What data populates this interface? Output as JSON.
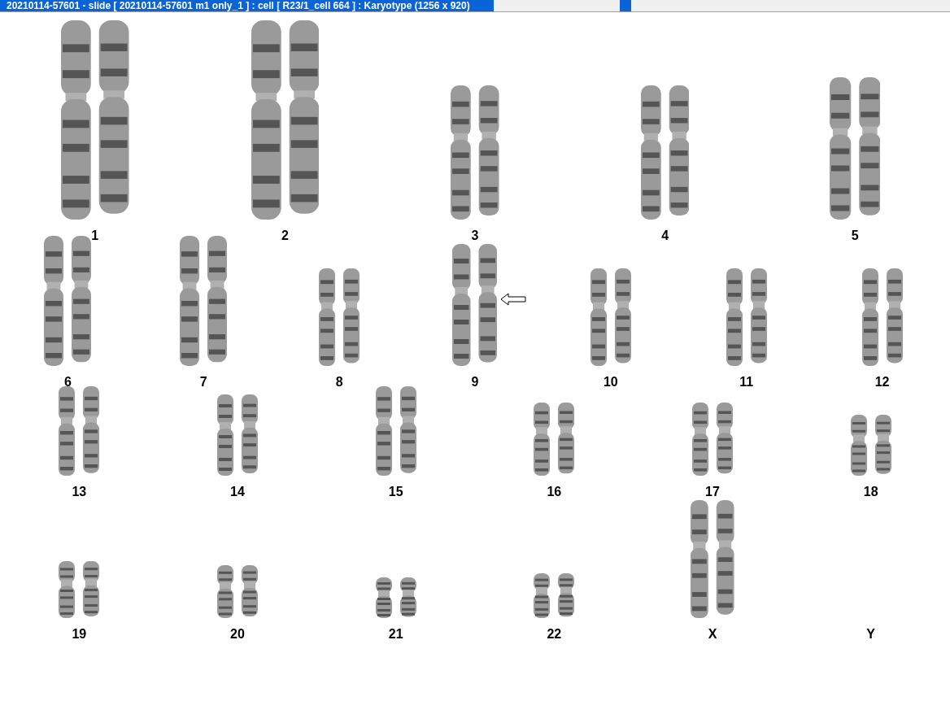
{
  "window": {
    "title": "20210114-57601 - slide [ 20210114-57601 m1 only_1 ] : cell [ R23/1_cell 664 ] : Karyotype  (1256 x 920)"
  },
  "rows": [
    {
      "pairs": [
        {
          "label": "1",
          "kind": "pair",
          "marked": false
        },
        {
          "label": "2",
          "kind": "pair",
          "marked": false
        },
        {
          "label": "3",
          "kind": "pair",
          "marked": false
        },
        {
          "label": "4",
          "kind": "pair",
          "marked": false
        },
        {
          "label": "5",
          "kind": "pair",
          "marked": false
        }
      ]
    },
    {
      "pairs": [
        {
          "label": "6",
          "kind": "pair",
          "marked": false
        },
        {
          "label": "7",
          "kind": "pair",
          "marked": false
        },
        {
          "label": "8",
          "kind": "pair",
          "marked": false
        },
        {
          "label": "9",
          "kind": "pair",
          "marked": true
        },
        {
          "label": "10",
          "kind": "pair",
          "marked": false
        },
        {
          "label": "11",
          "kind": "pair",
          "marked": false
        },
        {
          "label": "12",
          "kind": "pair",
          "marked": false
        }
      ]
    },
    {
      "pairs": [
        {
          "label": "13",
          "kind": "pair",
          "marked": false
        },
        {
          "label": "14",
          "kind": "pair",
          "marked": false
        },
        {
          "label": "15",
          "kind": "pair",
          "marked": false
        },
        {
          "label": "16",
          "kind": "pair",
          "marked": false
        },
        {
          "label": "17",
          "kind": "pair",
          "marked": false
        },
        {
          "label": "18",
          "kind": "pair",
          "marked": false
        }
      ]
    },
    {
      "pairs": [
        {
          "label": "19",
          "kind": "pair",
          "marked": false
        },
        {
          "label": "20",
          "kind": "pair",
          "marked": false
        },
        {
          "label": "21",
          "kind": "pair",
          "marked": false
        },
        {
          "label": "22",
          "kind": "pair",
          "marked": false
        },
        {
          "label": "X",
          "kind": "pair",
          "marked": false
        },
        {
          "label": "Y",
          "kind": "empty",
          "marked": false
        }
      ]
    }
  ]
}
